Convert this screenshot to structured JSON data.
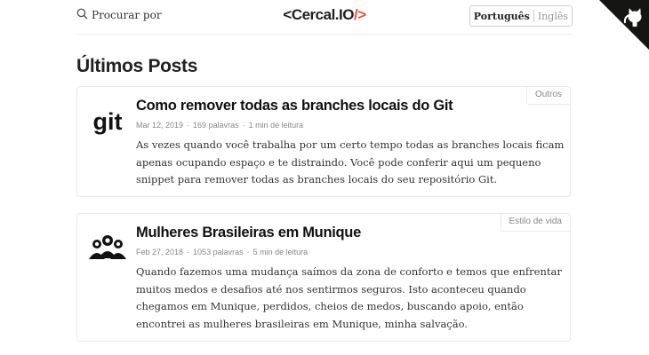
{
  "header": {
    "search_label": "Procurar por",
    "logo": {
      "open": "<",
      "name": "Cercal.IO",
      "close": "/>"
    },
    "languages": {
      "active": "Português",
      "other": "Inglês"
    }
  },
  "section_title": "Últimos Posts",
  "posts": [
    {
      "tag": "Outros",
      "thumb_text": "git",
      "title": "Como remover todas as branches locais do Git",
      "date": "Mar 12, 2019",
      "words": "169 palavras",
      "reading": "1 min de leitura",
      "excerpt": "As vezes quando você trabalha por um certo tempo todas as branches locais ficam apenas ocupando espaço e te distraindo. Você pode conferir aqui um pequeno snippet para remover todas as branches locais do seu repositório Git."
    },
    {
      "tag": "Estilo de vida",
      "title": "Mulheres Brasileiras em Munique",
      "date": "Feb 27, 2018",
      "words": "1053 palavras",
      "reading": "5 min de leitura",
      "excerpt": "Quando fazemos uma mudança saímos da zona de conforto e temos que enfrentar muitos medos e desafios até nos sentirmos seguros. Isto aconteceu quando chegamos em Munique, perdidos, cheios de medos, buscando apoio, então encontrei as mulheres brasileiras em Munique, minha salvação."
    }
  ],
  "icons": {
    "search": "search-icon",
    "github_corner": "github-octocat-icon",
    "post_1_thumb": "git-logo",
    "post_2_thumb": "women-group-icon"
  },
  "colors": {
    "accent": "#e2553a",
    "corner": "#151513",
    "text": "#222222"
  }
}
